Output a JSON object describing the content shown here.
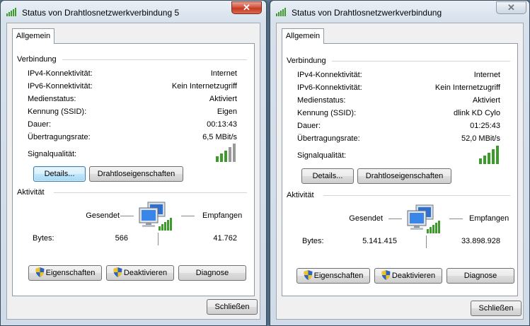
{
  "colors": {
    "signal_active": "#3c9b2a",
    "signal_inactive": "#9a9a9a",
    "close_button": "#c43a24"
  },
  "windows": [
    {
      "title": "Status von Drahtlosnetzwerkverbindung 5",
      "active": true,
      "tab": "Allgemein",
      "connection": {
        "group_title": "Verbindung",
        "rows": [
          {
            "label": "IPv4-Konnektivität:",
            "value": "Internet"
          },
          {
            "label": "IPv6-Konnektivität:",
            "value": "Kein Internetzugriff"
          },
          {
            "label": "Medienstatus:",
            "value": "Aktiviert"
          },
          {
            "label": "Kennung (SSID):",
            "value": "Eigen"
          },
          {
            "label": "Dauer:",
            "value": "00:13:43"
          },
          {
            "label": "Übertragungsrate:",
            "value": "6,5 MBit/s"
          }
        ],
        "signal_label": "Signalqualität:",
        "signal_bars": 3,
        "details_button": "Details...",
        "wireless_props_button": "Drahtloseigenschaften"
      },
      "activity": {
        "group_title": "Aktivität",
        "sent_label": "Gesendet",
        "received_label": "Empfangen",
        "bytes_label": "Bytes:",
        "bytes_sent": "566",
        "bytes_received": "41.762"
      },
      "buttons": {
        "properties": "Eigenschaften",
        "disable": "Deaktivieren",
        "diagnose": "Diagnose",
        "close": "Schließen"
      }
    },
    {
      "title": "Status von Drahtlosnetzwerkverbindung",
      "active": false,
      "tab": "Allgemein",
      "connection": {
        "group_title": "Verbindung",
        "rows": [
          {
            "label": "IPv4-Konnektivität:",
            "value": "Internet"
          },
          {
            "label": "IPv6-Konnektivität:",
            "value": "Kein Internetzugriff"
          },
          {
            "label": "Medienstatus:",
            "value": "Aktiviert"
          },
          {
            "label": "Kennung (SSID):",
            "value": "dlink KD Cylo"
          },
          {
            "label": "Dauer:",
            "value": "01:25:43"
          },
          {
            "label": "Übertragungsrate:",
            "value": "52,0 MBit/s"
          }
        ],
        "signal_label": "Signalqualität:",
        "signal_bars": 5,
        "details_button": "Details...",
        "wireless_props_button": "Drahtloseigenschaften"
      },
      "activity": {
        "group_title": "Aktivität",
        "sent_label": "Gesendet",
        "received_label": "Empfangen",
        "bytes_label": "Bytes:",
        "bytes_sent": "5.141.415",
        "bytes_received": "33.898.928"
      },
      "buttons": {
        "properties": "Eigenschaften",
        "disable": "Deaktivieren",
        "diagnose": "Diagnose",
        "close": "Schließen"
      }
    }
  ]
}
